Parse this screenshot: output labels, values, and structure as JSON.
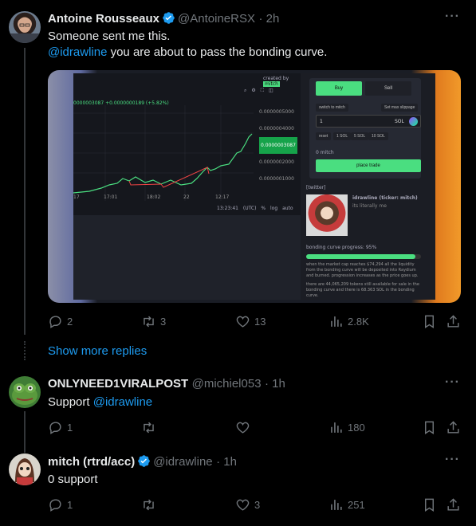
{
  "tweets": [
    {
      "name": "Antoine Rousseaux",
      "handle": "@AntoineRSX",
      "time": "· 2h",
      "line1": "Someone sent me this.",
      "line2_mention": "@idrawline",
      "line2_rest": " you are about to pass the bonding curve.",
      "replies": "2",
      "retweets": "3",
      "likes": "13",
      "views": "2.8K"
    },
    {
      "name": "ONLYNEED1VIRALPOST",
      "handle": "@michiel053",
      "time": "· 1h",
      "text": "Support ",
      "mention": "@idrawline",
      "replies": "1",
      "retweets": "",
      "likes": "",
      "views": "180"
    },
    {
      "name": "mitch (rtrd/acc)",
      "handle": "@idrawline",
      "time": "· 1h",
      "text": "0 support",
      "replies": "1",
      "retweets": "",
      "likes": "3",
      "views": "251"
    }
  ],
  "show_more": "Show more replies",
  "screenshot": {
    "created_by": "created by",
    "creator": "mitch",
    "price_line": "0000003087 +0.0000000189 (+5.82%)",
    "y_ticks": [
      "0.0000005000",
      "0.0000004000",
      "0.0000003087",
      "0.0000002000",
      "0.0000001000"
    ],
    "x_ticks": [
      "17",
      "17:01",
      "18:02",
      "22",
      "12:17"
    ],
    "time": "13:23:41 (UTC)",
    "pct": "%",
    "log": "log",
    "auto": "auto",
    "buy": "Buy",
    "sell": "Sell",
    "switch": "switch to mitch",
    "slippage": "Set max slippage",
    "amount": "1",
    "currency": "SOL",
    "presets": [
      "reset",
      "1 SOL",
      "5 SOL",
      "10 SOL"
    ],
    "receive": "0 mitch",
    "place_trade": "place trade",
    "twitter": "[twitter]",
    "token_name": "idrawline (ticker: mitch)",
    "token_desc": "its literally me",
    "progress_label": "bonding curve progress: 95%",
    "progress": 0.95,
    "info1": "when the market cap reaches $74,294 all the liquidity from the bonding curve will be deposited into Raydium and burned. progression increases as the price goes up.",
    "info2": "there are 44,065,209 tokens still available for sale in the bonding curve and there is 68.363 SOL in the bonding curve."
  },
  "colors": {
    "link": "#1d9bf0",
    "muted": "#71767b",
    "accent_green": "#4ade80",
    "chart_red": "#ef4444"
  }
}
